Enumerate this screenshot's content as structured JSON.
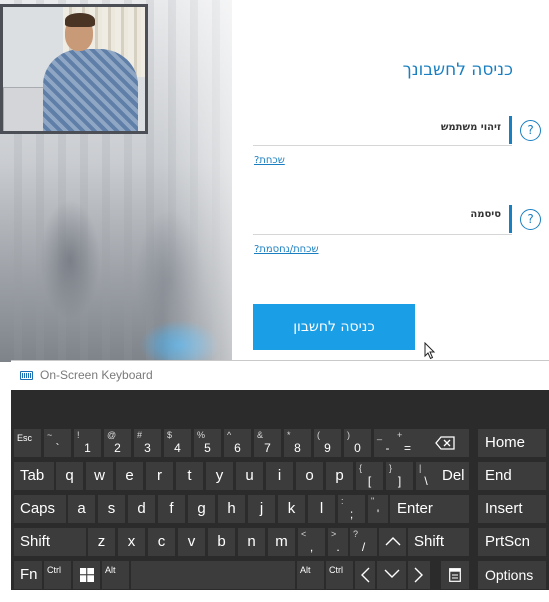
{
  "login": {
    "title": "כניסה לחשבונך",
    "username_label": "זיהוי משתמש",
    "username_help": "?",
    "username_forgot": "שכחת?",
    "password_label": "סיסמה",
    "password_help": "?",
    "password_forgot": "שכחת/נחסמת?",
    "submit_label": "כניסה לחשבון",
    "accent_color": "#1a7fc1",
    "button_color": "#1a9ee6"
  },
  "osk": {
    "title": "On-Screen Keyboard",
    "icon": "keyboard-icon",
    "row1": [
      {
        "sub": "Esc",
        "main": ""
      },
      {
        "sub": "~",
        "main": "`"
      },
      {
        "sub": "!",
        "main": "1"
      },
      {
        "sub": "@",
        "main": "2"
      },
      {
        "sub": "#",
        "main": "3"
      },
      {
        "sub": "$",
        "main": "4"
      },
      {
        "sub": "%",
        "main": "5"
      },
      {
        "sub": "^",
        "main": "6"
      },
      {
        "sub": "&",
        "main": "7"
      },
      {
        "sub": "*",
        "main": "8"
      },
      {
        "sub": "(",
        "main": "9"
      },
      {
        "sub": ")",
        "main": "0"
      },
      {
        "sub": "_",
        "main": "-"
      },
      {
        "sub": "+",
        "main": "="
      }
    ],
    "backspace_icon": "backspace-icon",
    "home": "Home",
    "row2": [
      "Tab",
      "q",
      "w",
      "e",
      "r",
      "t",
      "y",
      "u",
      "i",
      "o",
      "p"
    ],
    "row2_brackets": [
      {
        "sub": "{",
        "main": "["
      },
      {
        "sub": "}",
        "main": "]"
      },
      {
        "sub": "|",
        "main": "\\"
      }
    ],
    "del": "Del",
    "end": "End",
    "row3": [
      "Caps",
      "a",
      "s",
      "d",
      "f",
      "g",
      "h",
      "j",
      "k",
      "l"
    ],
    "row3_punct": [
      {
        "sub": ":",
        "main": ";"
      },
      {
        "sub": "\"",
        "main": "'"
      }
    ],
    "enter": "Enter",
    "insert": "Insert",
    "row4": [
      "Shift",
      "z",
      "x",
      "c",
      "v",
      "b",
      "n",
      "m"
    ],
    "row4_punct": [
      {
        "sub": "<",
        "main": ","
      },
      {
        "sub": ">",
        "main": "."
      },
      {
        "sub": "?",
        "main": "/"
      }
    ],
    "up_icon": "arrow-up-icon",
    "shift_right": "Shift",
    "prtscn": "PrtScn",
    "fn": "Fn",
    "ctrl": "Ctrl",
    "win_icon": "windows-icon",
    "alt": "Alt",
    "alt_right": "Alt",
    "ctrl_right": "Ctrl",
    "left_icon": "arrow-left-icon",
    "down_icon": "arrow-down-icon",
    "right_icon": "arrow-right-icon",
    "menu_icon": "context-menu-icon",
    "options": "Options"
  }
}
